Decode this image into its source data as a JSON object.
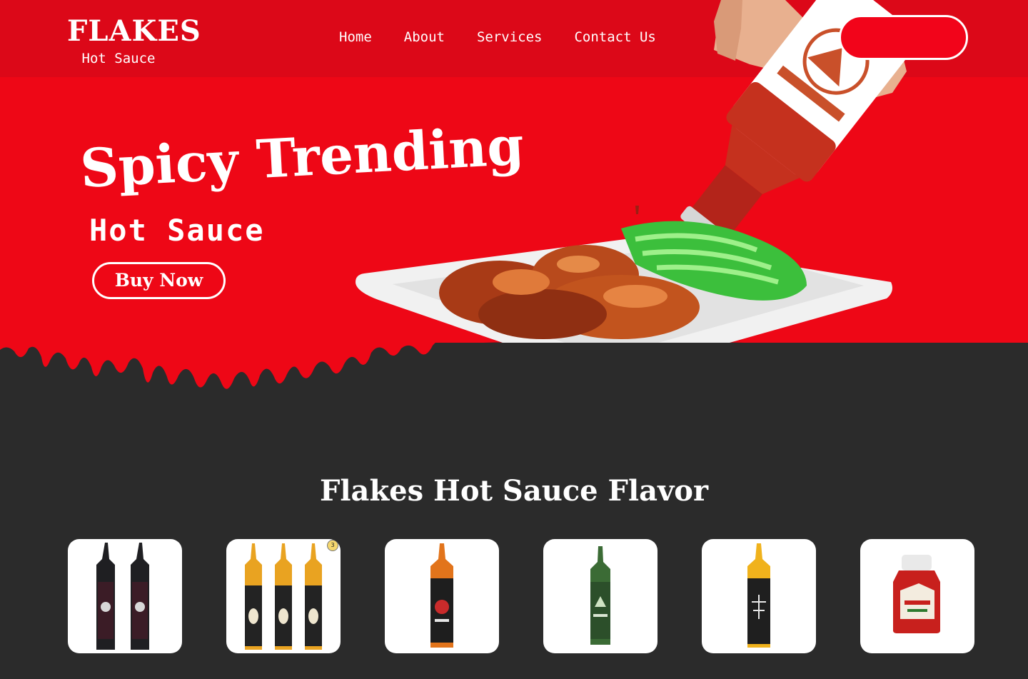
{
  "brand": {
    "name": "FLAKES",
    "tagline": "Hot Sauce"
  },
  "nav": {
    "items": [
      "Home",
      "About",
      "Services",
      "Contact Us"
    ]
  },
  "header": {
    "cta_label": ""
  },
  "hero": {
    "headline": "Spicy Trending",
    "subheadline": "Hot Sauce",
    "buy_label": "Buy Now"
  },
  "flavors": {
    "title": "Flakes Hot Sauce Flavor",
    "items": [
      {
        "name": "black-bottles-twin-pack",
        "color": "#5a1a2a"
      },
      {
        "name": "pineapple-habanero-three-pack",
        "color": "#e9a321",
        "badge": "3"
      },
      {
        "name": "orange-sauce-bottle",
        "color": "#e2741b"
      },
      {
        "name": "green-camp-sauce-bottle",
        "color": "#3b6b35"
      },
      {
        "name": "yellow-sauce-bottle",
        "color": "#f0b21c"
      },
      {
        "name": "heinz-tomato-ketchup-jar",
        "color": "#c8201d"
      }
    ]
  },
  "colors": {
    "hero_red": "#ee0716",
    "topbar_red": "#dc0818",
    "dark": "#2b2b2b",
    "white": "#ffffff"
  }
}
